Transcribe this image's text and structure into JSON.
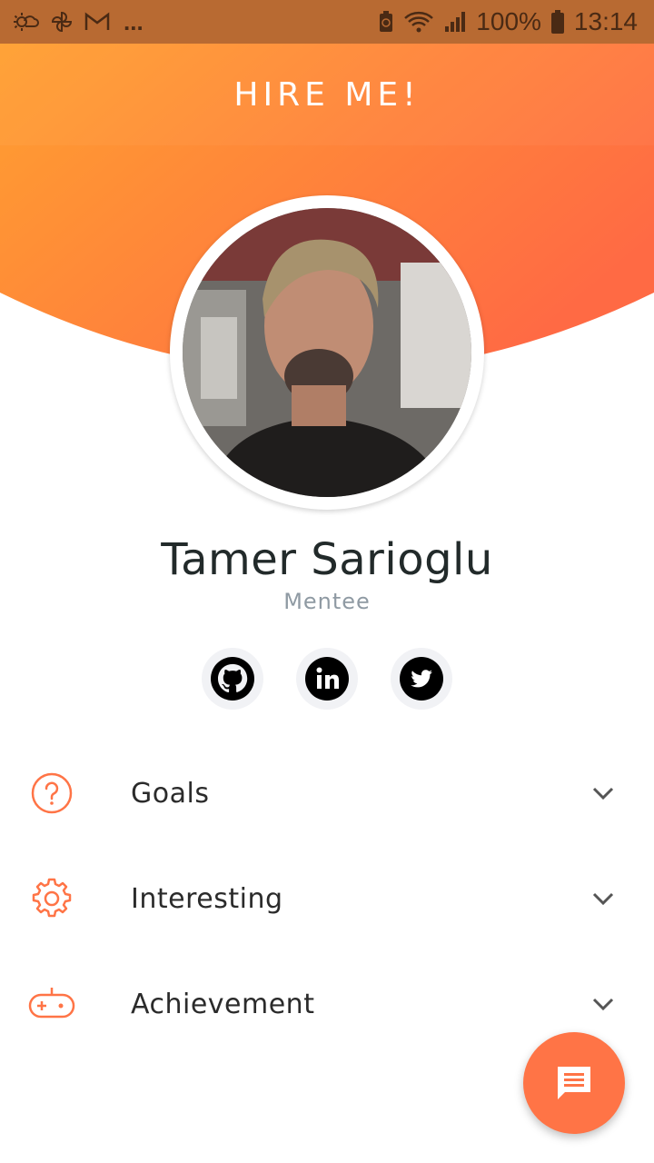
{
  "status_bar": {
    "icons_left": [
      "weather-icon",
      "pinwheel-icon",
      "gmail-icon"
    ],
    "more": "...",
    "battery": "100%",
    "time": "13:14"
  },
  "header": {
    "hire_label": "HIRE ME!"
  },
  "profile": {
    "name": "Tamer Sarioglu",
    "role": "Mentee"
  },
  "socials": [
    "github-icon",
    "linkedin-icon",
    "twitter-icon"
  ],
  "sections": [
    {
      "label": "Goals",
      "icon": "question-icon"
    },
    {
      "label": "Interesting",
      "icon": "gear-icon"
    },
    {
      "label": "Achievement",
      "icon": "gamepad-icon"
    }
  ],
  "colors": {
    "accent": "#ff7446",
    "gradient_start": "#ffa030",
    "gradient_end": "#ff6a44"
  },
  "fab": {
    "icon": "chat-icon"
  }
}
